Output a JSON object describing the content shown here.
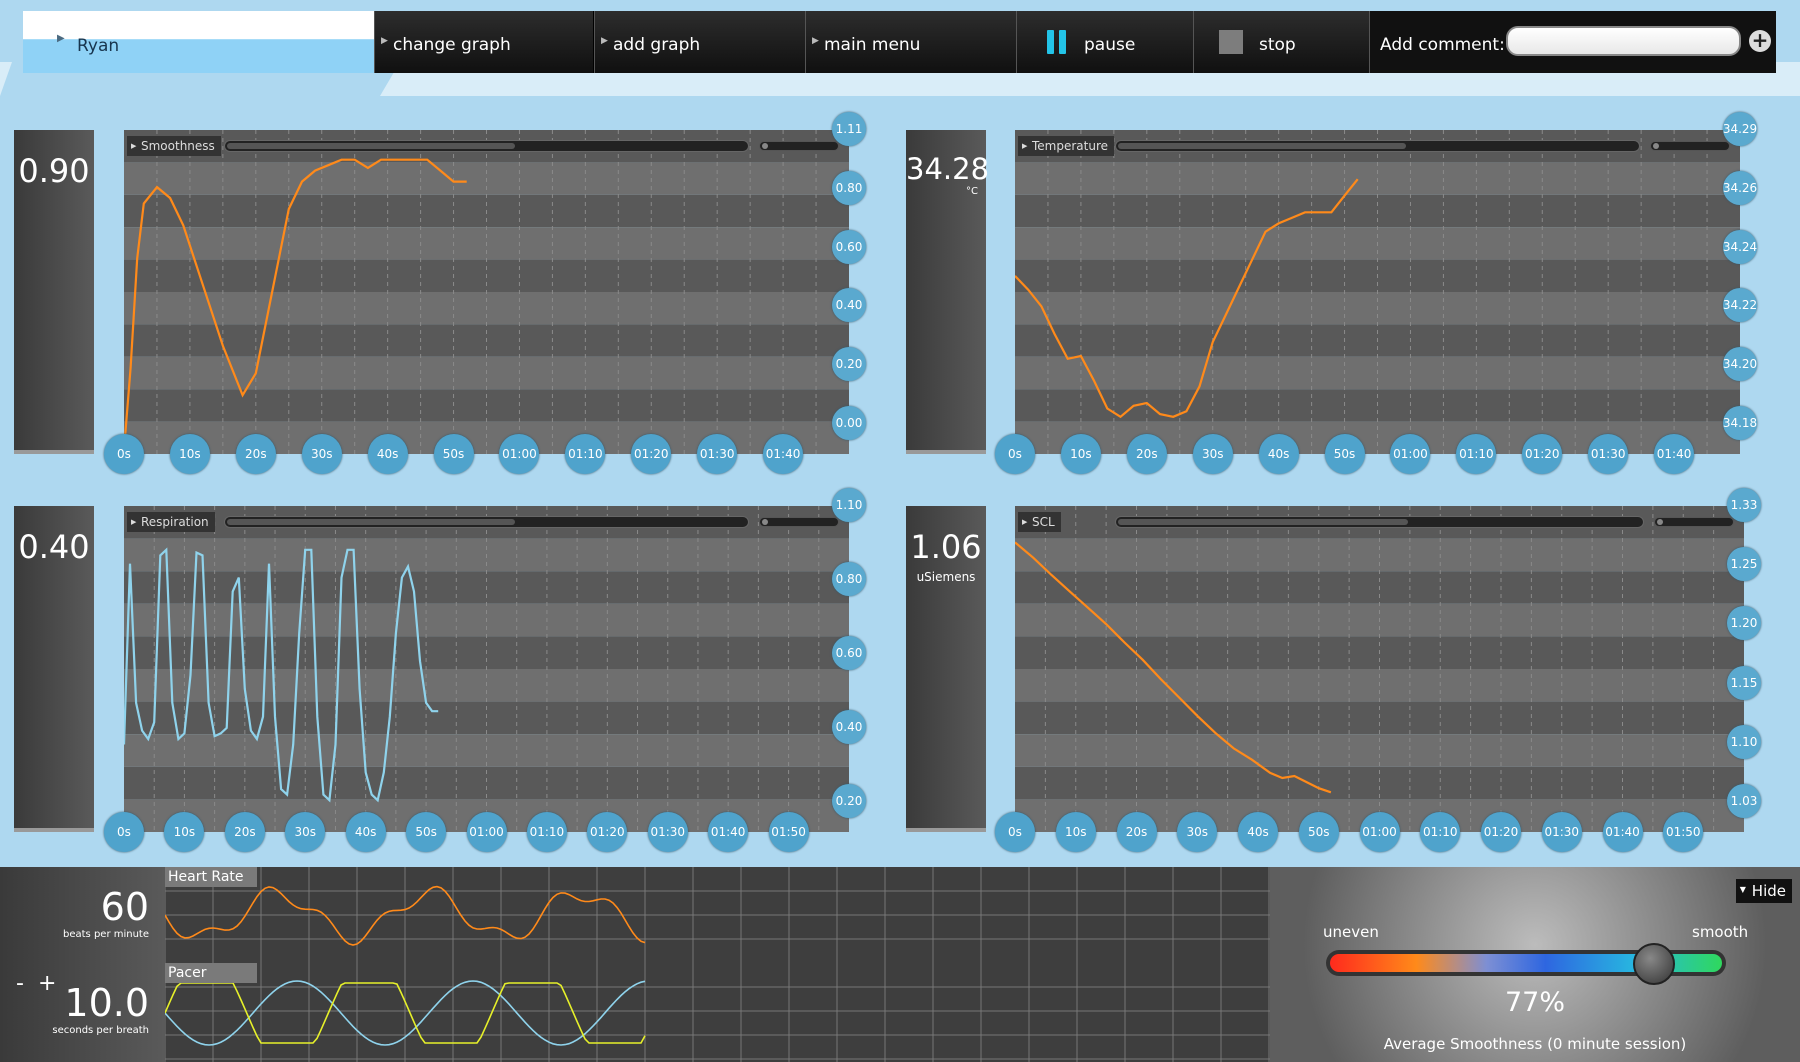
{
  "toolbar": {
    "user": "Ryan",
    "change_graph": "change graph",
    "add_graph": "add graph",
    "main_menu": "main menu",
    "pause": "pause",
    "stop": "stop",
    "add_comment": "Add comment:",
    "comment_value": "",
    "plus": "+"
  },
  "panels": {
    "smoothness": {
      "value": "0.90",
      "unit": "",
      "title": "Smoothness"
    },
    "temperature": {
      "value": "34.28",
      "unit": "°C",
      "title": "Temperature"
    },
    "respiration": {
      "value": "0.40",
      "unit": "",
      "title": "Respiration"
    },
    "scl": {
      "value": "1.06",
      "unit": "uSiemens",
      "title": "SCL"
    }
  },
  "bottom": {
    "heart_rate": {
      "label": "Heart Rate",
      "value": "60",
      "unit": "beats per minute"
    },
    "pacer": {
      "label": "Pacer",
      "value": "10.0",
      "unit": "seconds per breath",
      "minus": "-",
      "plus": "+"
    },
    "smooth": {
      "left": "uneven",
      "right": "smooth",
      "percent": "77%",
      "percent_fraction": 0.77,
      "caption": "Average Smoothness (0 minute session)",
      "hide": "Hide"
    }
  },
  "colors": {
    "orange": "#ff8a1a",
    "blue": "#8fd3ec",
    "yellow": "#e6f02a",
    "bubble": "#5aa9cf"
  },
  "chart_data": [
    {
      "type": "line",
      "title": "Smoothness",
      "x_ticks": [
        "0s",
        "10s",
        "20s",
        "30s",
        "40s",
        "50s",
        "01:00",
        "01:10",
        "01:20",
        "01:30",
        "01:40"
      ],
      "y_ticks": [
        "1.11",
        "0.80",
        "0.60",
        "0.40",
        "0.20",
        "0.00"
      ],
      "ylim": [
        0.0,
        1.11
      ],
      "series": [
        {
          "color": "#ff8a1a",
          "x": [
            0,
            1,
            2,
            3,
            5,
            7,
            9,
            12,
            15,
            18,
            20,
            22,
            25,
            27,
            29,
            31,
            33,
            35,
            37,
            39,
            40,
            42,
            44,
            46,
            48,
            50,
            52
          ],
          "y": [
            0.0,
            0.3,
            0.7,
            0.9,
            0.96,
            0.92,
            0.82,
            0.6,
            0.38,
            0.2,
            0.28,
            0.52,
            0.88,
            0.98,
            1.02,
            1.04,
            1.06,
            1.06,
            1.03,
            1.06,
            1.06,
            1.06,
            1.06,
            1.06,
            1.02,
            0.98,
            0.98
          ]
        }
      ]
    },
    {
      "type": "line",
      "title": "Temperature",
      "x_ticks": [
        "0s",
        "10s",
        "20s",
        "30s",
        "40s",
        "50s",
        "01:00",
        "01:10",
        "01:20",
        "01:30",
        "01:40"
      ],
      "y_ticks": [
        "34.29",
        "34.26",
        "34.24",
        "34.22",
        "34.20",
        "34.18"
      ],
      "ylim": [
        34.18,
        34.29
      ],
      "series": [
        {
          "color": "#ff8a1a",
          "x": [
            0,
            2,
            4,
            6,
            8,
            10,
            12,
            14,
            16,
            18,
            20,
            22,
            24,
            26,
            28,
            30,
            32,
            34,
            36,
            38,
            40,
            42,
            44,
            46,
            48,
            50,
            52
          ],
          "y": [
            34.243,
            34.238,
            34.232,
            34.222,
            34.213,
            34.214,
            34.205,
            34.195,
            34.192,
            34.196,
            34.197,
            34.193,
            34.192,
            34.194,
            34.203,
            34.219,
            34.229,
            34.239,
            34.249,
            34.259,
            34.262,
            34.264,
            34.266,
            34.266,
            34.266,
            34.272,
            34.278
          ]
        }
      ]
    },
    {
      "type": "line",
      "title": "Respiration",
      "x_ticks": [
        "0s",
        "10s",
        "20s",
        "30s",
        "40s",
        "50s",
        "01:00",
        "01:10",
        "01:20",
        "01:30",
        "01:40",
        "01:50"
      ],
      "y_ticks": [
        "1.10",
        "0.80",
        "0.60",
        "0.40",
        "0.20"
      ],
      "ylim": [
        0.0,
        1.1
      ],
      "series": [
        {
          "color": "#8fd3ec",
          "x": [
            0,
            1,
            2,
            3,
            4,
            5,
            6,
            7,
            8,
            9,
            10,
            11,
            12,
            13,
            14,
            15,
            16,
            17,
            18,
            19,
            20,
            21,
            22,
            23,
            24,
            25,
            26,
            27,
            28,
            29,
            30,
            31,
            32,
            33,
            34,
            35,
            36,
            37,
            38,
            39,
            40,
            41,
            42,
            43,
            44,
            45,
            46,
            47,
            48,
            49,
            50,
            51,
            52
          ],
          "y": [
            0.3,
            0.95,
            0.45,
            0.35,
            0.32,
            0.38,
            0.98,
            1.0,
            0.45,
            0.32,
            0.34,
            0.55,
            0.99,
            0.98,
            0.45,
            0.33,
            0.34,
            0.36,
            0.85,
            0.9,
            0.5,
            0.35,
            0.32,
            0.4,
            0.95,
            0.4,
            0.14,
            0.12,
            0.3,
            0.7,
            1.0,
            1.0,
            0.4,
            0.12,
            0.1,
            0.3,
            0.9,
            1.0,
            1.0,
            0.5,
            0.2,
            0.12,
            0.1,
            0.2,
            0.4,
            0.7,
            0.9,
            0.94,
            0.85,
            0.6,
            0.45,
            0.42,
            0.42
          ]
        }
      ]
    },
    {
      "type": "line",
      "title": "SCL",
      "x_ticks": [
        "0s",
        "10s",
        "20s",
        "30s",
        "40s",
        "50s",
        "01:00",
        "01:10",
        "01:20",
        "01:30",
        "01:40",
        "01:50"
      ],
      "y_ticks": [
        "1.33",
        "1.25",
        "1.20",
        "1.15",
        "1.10",
        "1.03"
      ],
      "ylim": [
        1.03,
        1.33
      ],
      "series": [
        {
          "color": "#ff8a1a",
          "x": [
            0,
            3,
            6,
            9,
            12,
            15,
            18,
            21,
            24,
            27,
            30,
            33,
            36,
            39,
            42,
            44,
            46,
            48,
            50,
            52
          ],
          "y": [
            1.31,
            1.295,
            1.278,
            1.262,
            1.246,
            1.23,
            1.212,
            1.195,
            1.176,
            1.158,
            1.14,
            1.123,
            1.108,
            1.097,
            1.084,
            1.079,
            1.081,
            1.075,
            1.069,
            1.065
          ]
        }
      ]
    }
  ]
}
